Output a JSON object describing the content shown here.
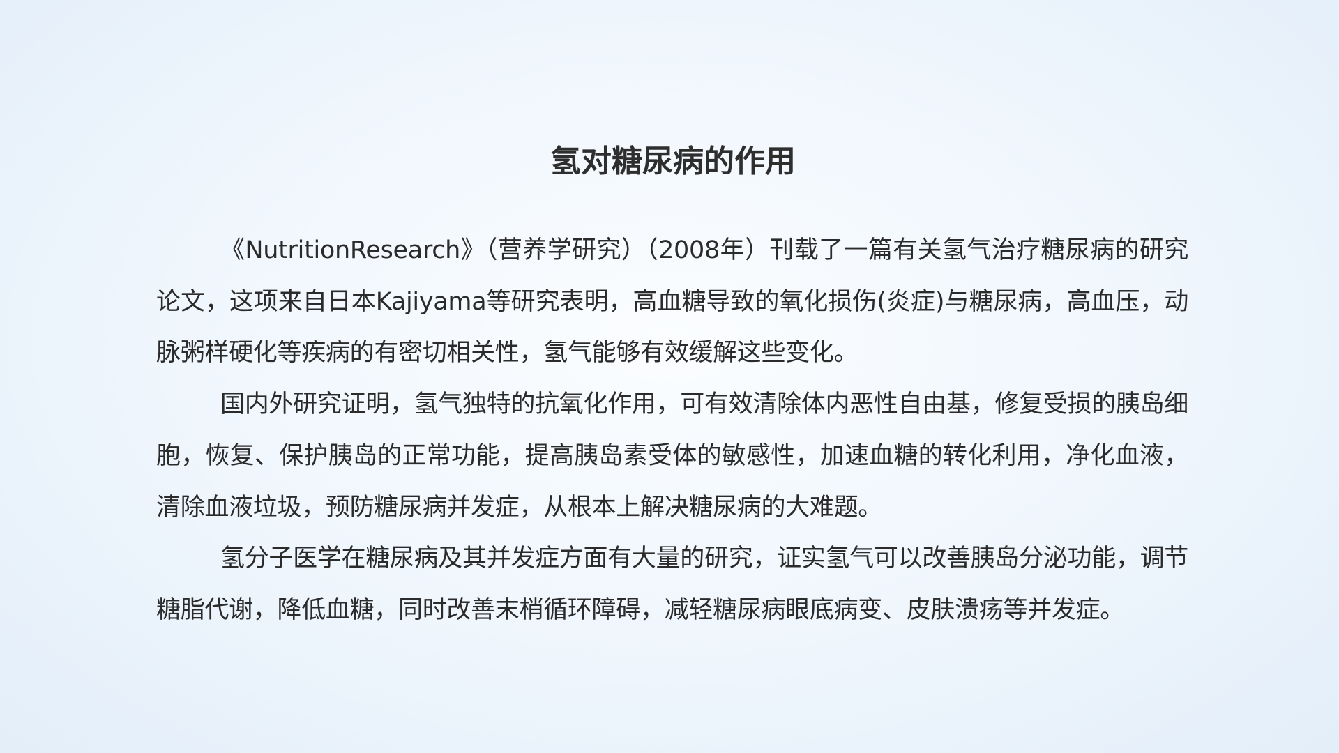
{
  "title": "氢对糖尿病的作用",
  "paragraphs": [
    "《NutritionResearch》（营养学研究）（2008年）刊载了一篇有关氢气治疗糖尿病的研究论文，这项来自日本Kajiyama等研究表明，高血糖导致的氧化损伤(炎症)与糖尿病，高血压，动脉粥样硬化等疾病的有密切相关性，氢气能够有效缓解这些变化。",
    "国内外研究证明，氢气独特的抗氧化作用，可有效清除体内恶性自由基，修复受损的胰岛细胞，恢复、保护胰岛的正常功能，提高胰岛素受体的敏感性，加速血糖的转化利用，净化血液，清除血液垃圾，预防糖尿病并发症，从根本上解决糖尿病的大难题。",
    "氢分子医学在糖尿病及其并发症方面有大量的研究，证实氢气可以改善胰岛分泌功能，调节糖脂代谢，降低血糖，同时改善末梢循环障碍，减轻糖尿病眼底病变、皮肤溃疡等并发症。"
  ]
}
